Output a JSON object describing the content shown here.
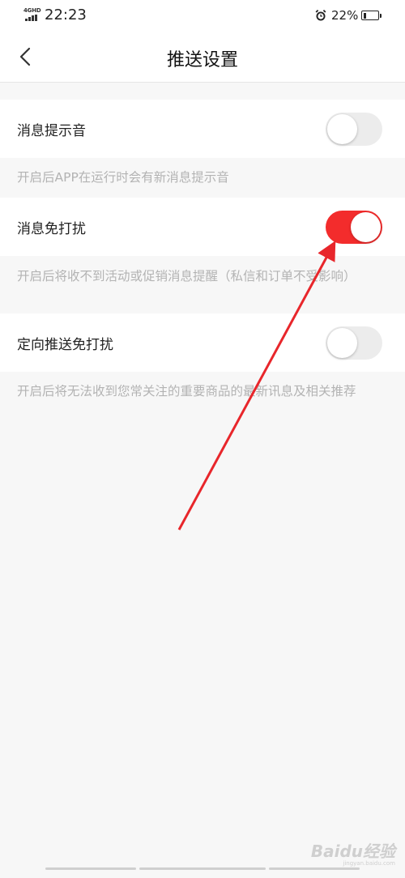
{
  "status_bar": {
    "network": "4GHD",
    "time": "22:23",
    "alarm_icon": "alarm-clock-icon",
    "battery_percent": "22%",
    "battery_level": 0.22
  },
  "header": {
    "back_icon": "chevron-left-icon",
    "title": "推送设置"
  },
  "settings": [
    {
      "label": "消息提示音",
      "enabled": false,
      "description": "开启后APP在运行时会有新消息提示音"
    },
    {
      "label": "消息免打扰",
      "enabled": true,
      "description": "开启后将收不到活动或促销消息提醒（私信和订单不受影响）"
    },
    {
      "label": "定向推送免打扰",
      "enabled": false,
      "description": "开启后将无法收到您常关注的重要商品的最新讯息及相关推荐"
    }
  ],
  "colors": {
    "toggle_on": "#f32c2c",
    "toggle_off": "#ececec",
    "annotation_arrow": "#e8262b"
  },
  "watermark": {
    "main": "Baidu经验",
    "sub": "jingyan.baidu.com"
  }
}
